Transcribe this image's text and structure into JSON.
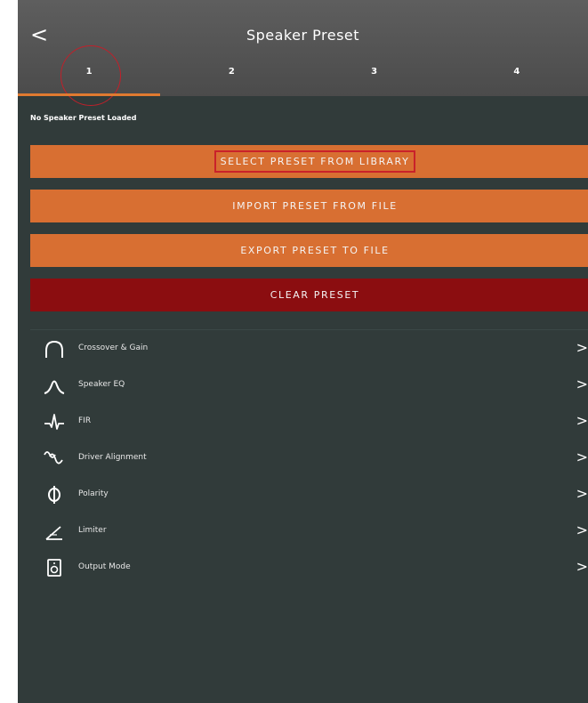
{
  "header": {
    "back_glyph": "<",
    "title": "Speaker Preset"
  },
  "tabs": [
    {
      "label": "1",
      "active": true
    },
    {
      "label": "2",
      "active": false
    },
    {
      "label": "3",
      "active": false
    },
    {
      "label": "4",
      "active": false
    }
  ],
  "status_text": "No Speaker Preset Loaded",
  "buttons": {
    "select": "SELECT PRESET FROM LIBRARY",
    "import": "IMPORT PRESET FROM FILE",
    "export": "EXPORT PRESET TO FILE",
    "clear": "CLEAR PRESET"
  },
  "menu": [
    {
      "label": "Crossover & Gain",
      "icon": "crossover-icon"
    },
    {
      "label": "Speaker EQ",
      "icon": "eq-curve-icon"
    },
    {
      "label": "FIR",
      "icon": "fir-icon"
    },
    {
      "label": "Driver Alignment",
      "icon": "alignment-icon"
    },
    {
      "label": "Polarity",
      "icon": "polarity-icon"
    },
    {
      "label": "Limiter",
      "icon": "limiter-icon"
    },
    {
      "label": "Output Mode",
      "icon": "speaker-icon"
    }
  ],
  "chevron_glyph": ">",
  "colors": {
    "accent_orange": "#d86f32",
    "clear_red": "#8b0d10",
    "background": "#313b3a",
    "header": "#555555",
    "highlight_red": "#c9222a"
  }
}
